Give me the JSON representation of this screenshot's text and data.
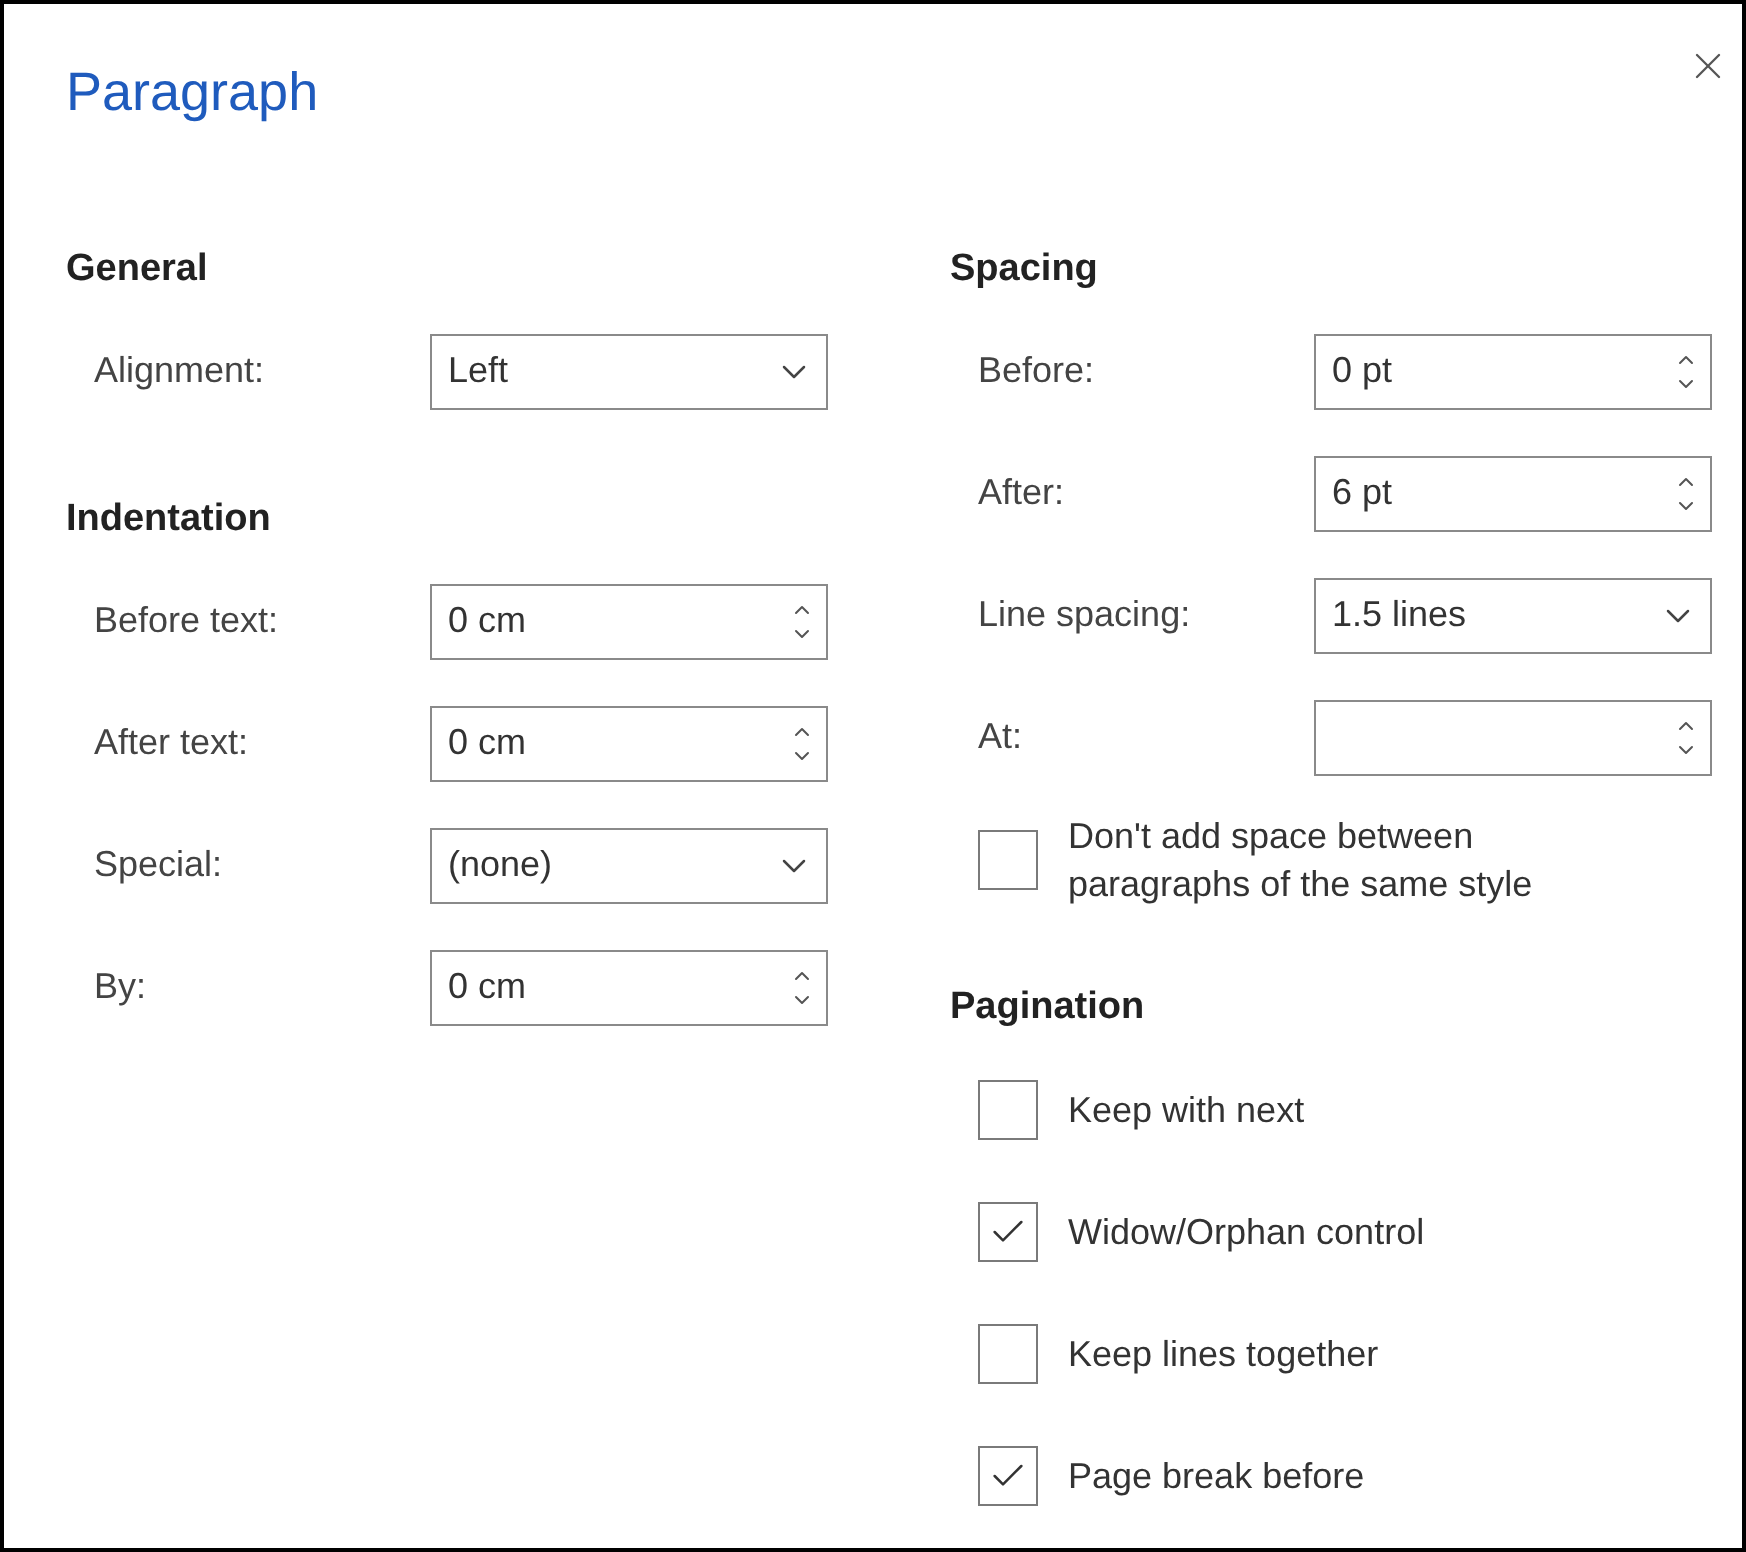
{
  "title": "Paragraph",
  "columns": [
    {
      "sections": [
        {
          "heading": "General",
          "rows": [
            {
              "kind": "select",
              "label": "Alignment:",
              "value": "Left"
            }
          ]
        },
        {
          "heading": "Indentation",
          "rows": [
            {
              "kind": "spin",
              "label": "Before text:",
              "value": "0 cm"
            },
            {
              "kind": "spin",
              "label": "After text:",
              "value": "0 cm"
            },
            {
              "kind": "select",
              "label": "Special:",
              "value": "(none)"
            },
            {
              "kind": "spin",
              "label": "By:",
              "value": "0 cm"
            }
          ]
        }
      ]
    },
    {
      "sections": [
        {
          "heading": "Spacing",
          "rows": [
            {
              "kind": "spin",
              "label": "Before:",
              "value": "0 pt"
            },
            {
              "kind": "spin",
              "label": "After:",
              "value": "6 pt"
            },
            {
              "kind": "select",
              "label": "Line spacing:",
              "value": "1.5 lines"
            },
            {
              "kind": "spin",
              "label": "At:"
            },
            {
              "kind": "checkbox",
              "label": "Don't add space between paragraphs of the same style",
              "checked": false
            }
          ]
        },
        {
          "heading": "Pagination",
          "rows": [
            {
              "kind": "checkbox",
              "label": "Keep with next",
              "checked": false
            },
            {
              "kind": "checkbox",
              "label": "Widow/Orphan control",
              "checked": true
            },
            {
              "kind": "checkbox",
              "label": "Keep lines together",
              "checked": false
            },
            {
              "kind": "checkbox",
              "label": "Page break before",
              "checked": true
            }
          ]
        }
      ]
    }
  ]
}
